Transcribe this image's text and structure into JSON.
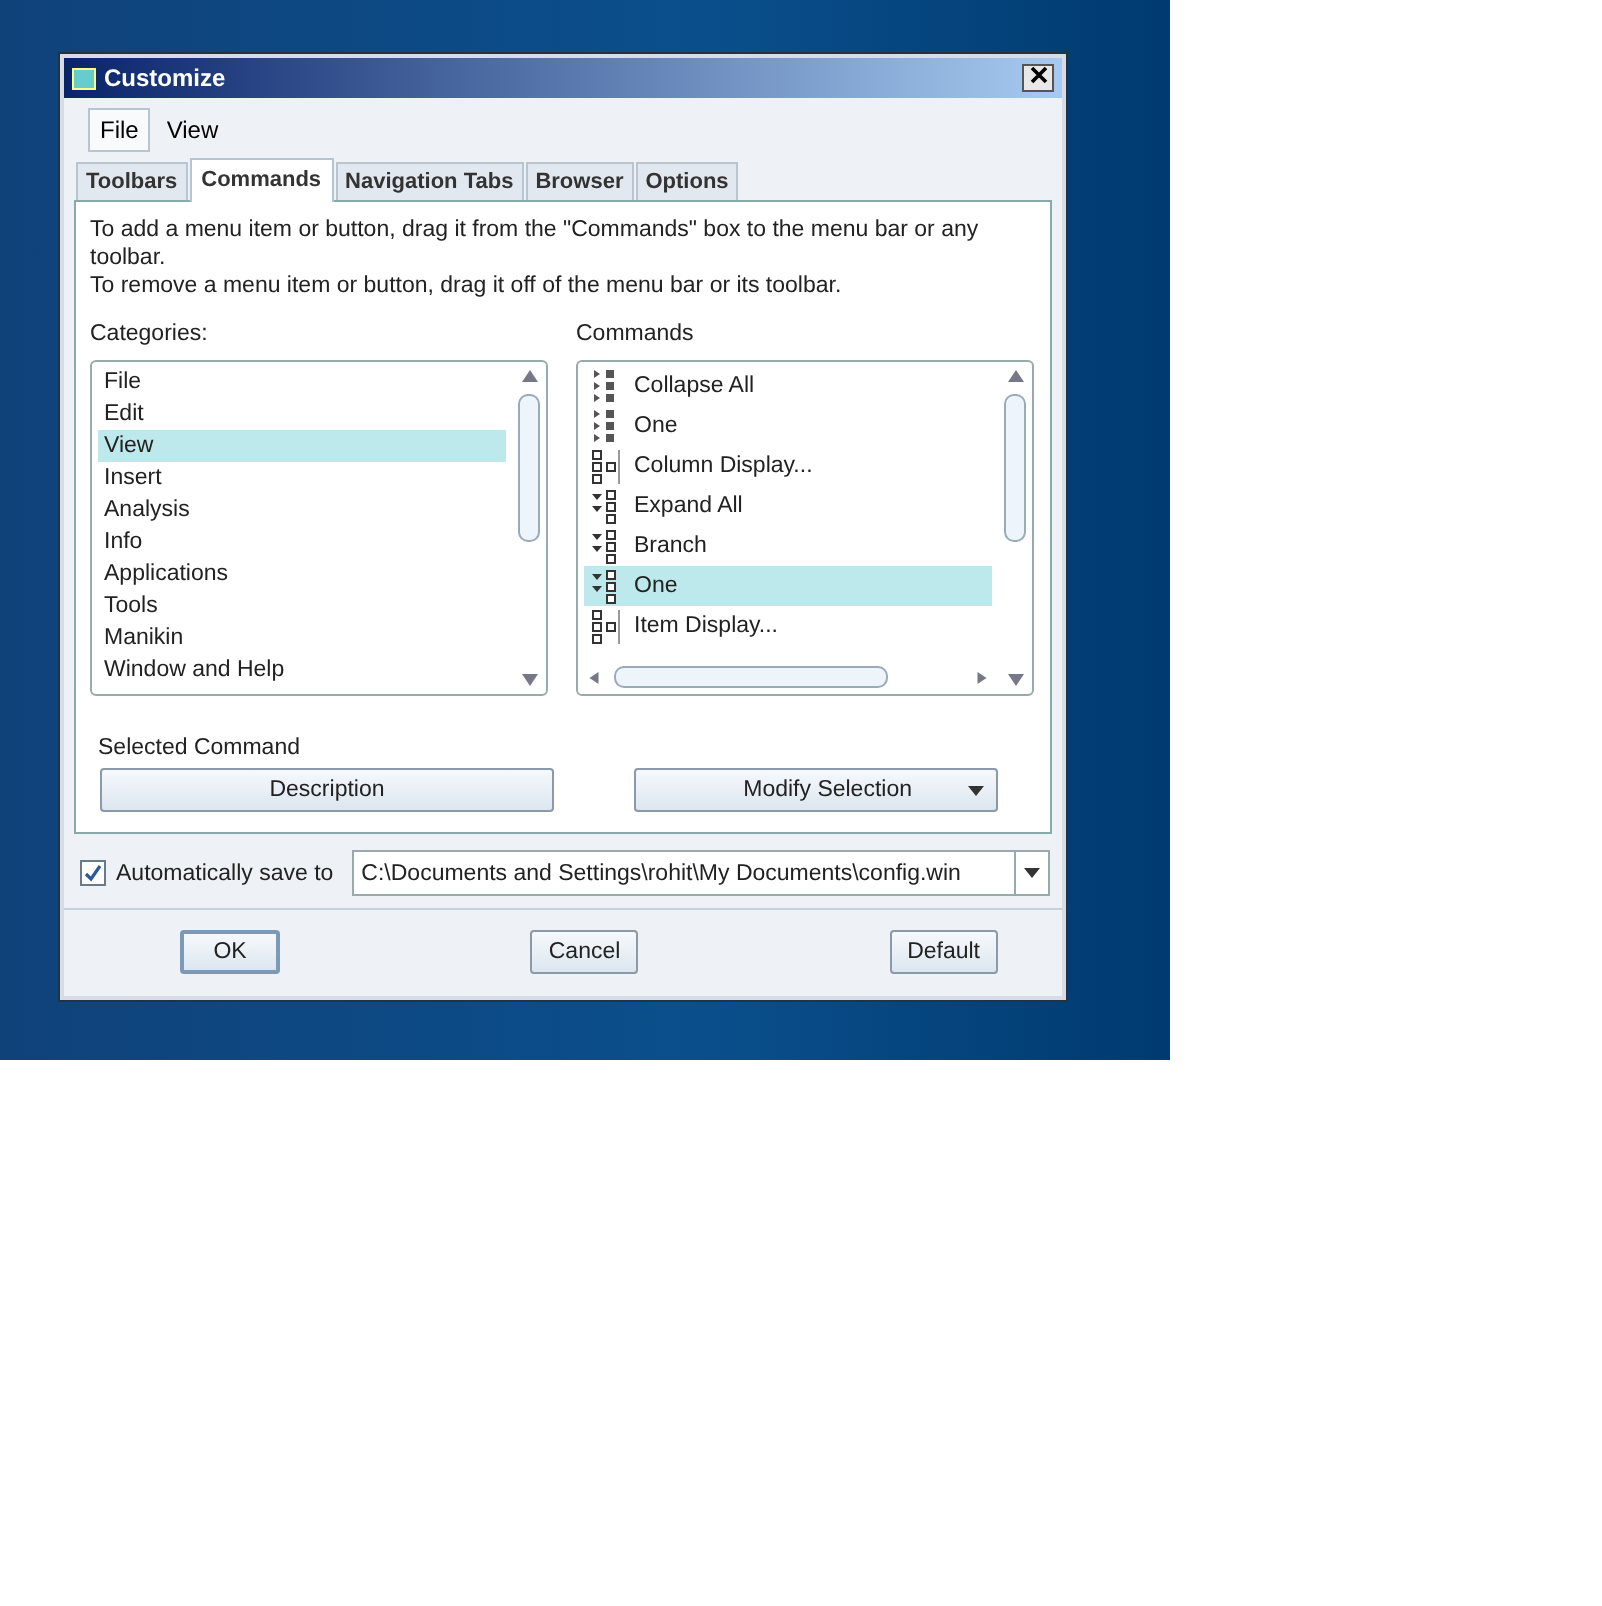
{
  "window": {
    "title": "Customize"
  },
  "menu": [
    {
      "label": "File",
      "selected": true
    },
    {
      "label": "View",
      "selected": false
    }
  ],
  "tabs": [
    {
      "label": "Toolbars",
      "selected": false
    },
    {
      "label": "Commands",
      "selected": true
    },
    {
      "label": "Navigation Tabs",
      "selected": false
    },
    {
      "label": "Browser",
      "selected": false
    },
    {
      "label": "Options",
      "selected": false
    }
  ],
  "instructions": [
    "To add a menu item or button, drag it from the \"Commands\" box to the menu bar or any toolbar.",
    "To remove a menu item or button, drag it off of the menu bar or its toolbar."
  ],
  "categories": {
    "label": "Categories:",
    "items": [
      {
        "label": "File",
        "selected": false
      },
      {
        "label": "Edit",
        "selected": false
      },
      {
        "label": "View",
        "selected": true
      },
      {
        "label": "Insert",
        "selected": false
      },
      {
        "label": "Analysis",
        "selected": false
      },
      {
        "label": "Info",
        "selected": false
      },
      {
        "label": "Applications",
        "selected": false
      },
      {
        "label": "Tools",
        "selected": false
      },
      {
        "label": "Manikin",
        "selected": false
      },
      {
        "label": "Window and Help",
        "selected": false
      }
    ]
  },
  "commands": {
    "label": "Commands",
    "items": [
      {
        "label": "Collapse All",
        "selected": false,
        "kind": "collapse"
      },
      {
        "label": "One",
        "selected": false,
        "kind": "collapse"
      },
      {
        "label": "Column Display...",
        "selected": false,
        "kind": "columns"
      },
      {
        "label": "Expand All",
        "selected": false,
        "kind": "expand"
      },
      {
        "label": "Branch",
        "selected": false,
        "kind": "expand"
      },
      {
        "label": "One",
        "selected": true,
        "kind": "expand"
      },
      {
        "label": "Item Display...",
        "selected": false,
        "kind": "columns"
      }
    ]
  },
  "selected_command": {
    "label": "Selected Command",
    "description_button": "Description",
    "modify_button": "Modify Selection"
  },
  "autosave": {
    "label": "Automatically save to",
    "checked": true,
    "path": "C:\\Documents and Settings\\rohit\\My Documents\\config.win"
  },
  "buttons": [
    "OK",
    "Cancel",
    "Default"
  ]
}
